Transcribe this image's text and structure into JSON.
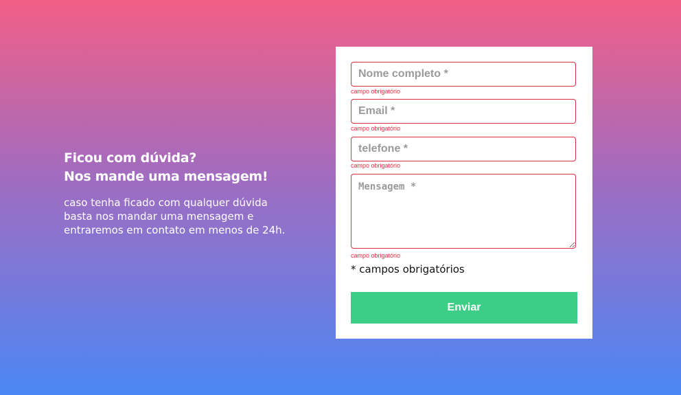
{
  "intro": {
    "heading_line1": "Ficou com dúvida?",
    "heading_line2": "Nos mande uma mensagem!",
    "text_line1": "caso tenha ficado com qualquer dúvida",
    "text_line2": "basta nos mandar uma mensagem e",
    "text_line3": "entraremos em contato em menos de 24h."
  },
  "form": {
    "name_placeholder": "Nome completo *",
    "email_placeholder": "Email *",
    "phone_placeholder": "telefone *",
    "message_placeholder": "Mensagem *",
    "error_text": "campo obrigatório",
    "required_note": "* campos obrigatórios",
    "submit_label": "Enviar"
  },
  "colors": {
    "gradient_top": "#f25f87",
    "gradient_bottom": "#4b87f5",
    "error": "#d7303f",
    "submit": "#3ccd87"
  }
}
